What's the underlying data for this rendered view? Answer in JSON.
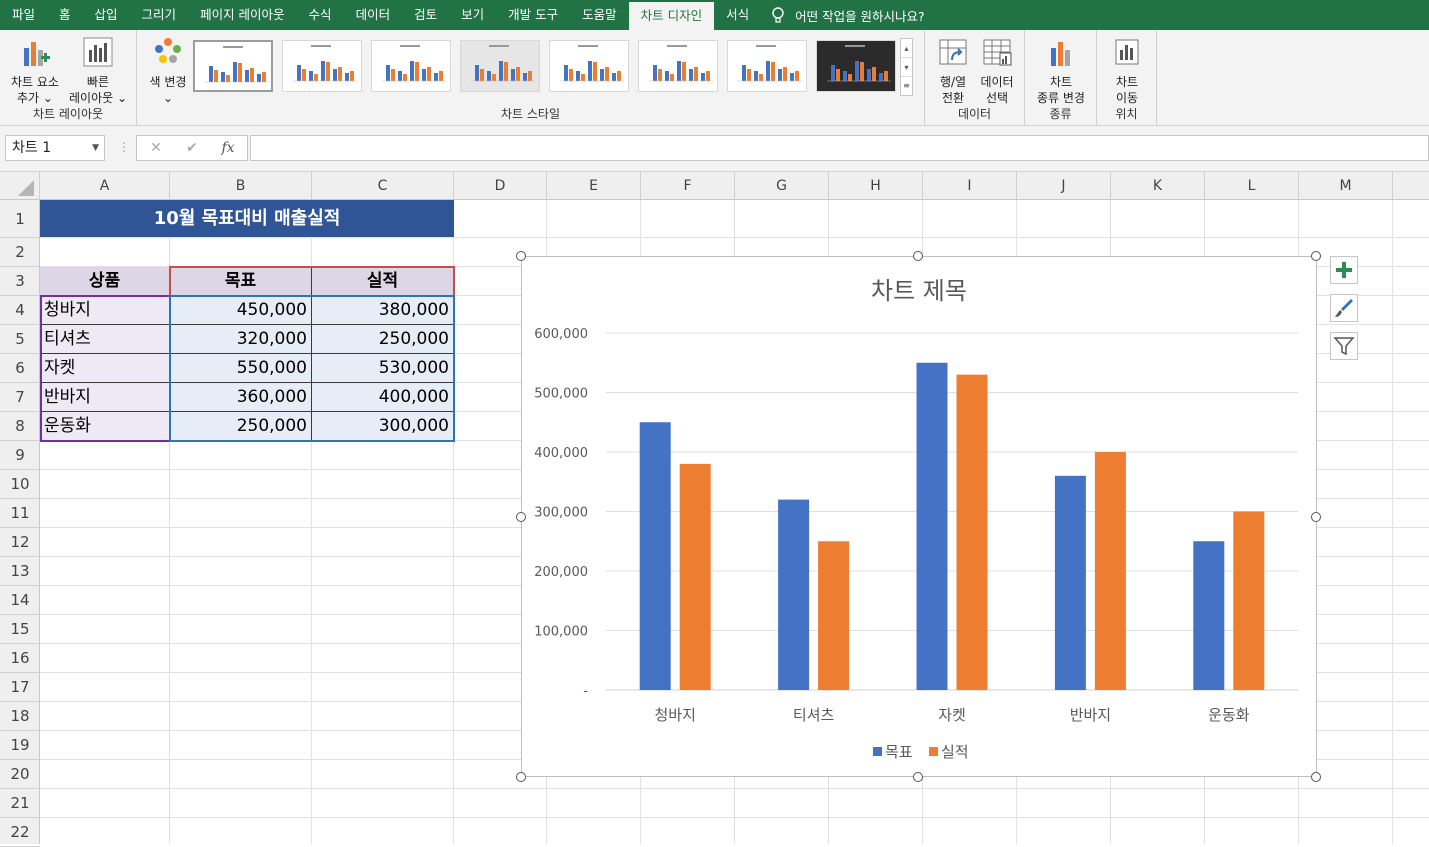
{
  "ribbon_tabs": [
    "파일",
    "홈",
    "삽입",
    "그리기",
    "페이지 레이아웃",
    "수식",
    "데이터",
    "검토",
    "보기",
    "개발 도구",
    "도움말",
    "차트 디자인",
    "서식"
  ],
  "active_tab": "차트 디자인",
  "tell_me": "어떤 작업을 원하시나요?",
  "ribbon": {
    "add_element": [
      "차트 요소",
      "추가 ⌄"
    ],
    "quick_layout": [
      "빠른",
      "레이아웃 ⌄"
    ],
    "layout_group": "차트 레이아웃",
    "change_colors": [
      "색 변경",
      "⌄"
    ],
    "styles_group": "차트 스타일",
    "switch_row_col": [
      "행/열",
      "전환"
    ],
    "select_data": [
      "데이터",
      "선택"
    ],
    "data_group": "데이터",
    "change_type": [
      "차트",
      "종류 변경"
    ],
    "type_group": "종류",
    "move_chart": [
      "차트",
      "이동"
    ],
    "location_group": "위치"
  },
  "formula_bar": {
    "name_box": "차트 1",
    "cancel": "✕",
    "enter": "✔",
    "fx": "fx",
    "formula": ""
  },
  "columns": [
    "A",
    "B",
    "C",
    "D",
    "E",
    "F",
    "G",
    "H",
    "I",
    "J",
    "K",
    "L",
    "M"
  ],
  "rows": [
    "1",
    "2",
    "3",
    "4",
    "5",
    "6",
    "7",
    "8",
    "9",
    "10",
    "11",
    "12",
    "13",
    "14",
    "15",
    "16",
    "17",
    "18",
    "19",
    "20",
    "21",
    "22"
  ],
  "sheet": {
    "title": "10월 목표대비 매출실적",
    "headers": [
      "상품",
      "목표",
      "실적"
    ],
    "data": [
      [
        "청바지",
        "450,000",
        "380,000"
      ],
      [
        "티셔츠",
        "320,000",
        "250,000"
      ],
      [
        "자켓",
        "550,000",
        "530,000"
      ],
      [
        "반바지",
        "360,000",
        "400,000"
      ],
      [
        "운동화",
        "250,000",
        "300,000"
      ]
    ],
    "title_bg": "#2f5597",
    "header_bg": "#dcd6e6",
    "name_bg": "#efe9f6",
    "num_bg": "#e6edf7"
  },
  "chart_data": {
    "type": "bar",
    "title": "차트 제목",
    "categories": [
      "청바지",
      "티셔츠",
      "자켓",
      "반바지",
      "운동화"
    ],
    "series": [
      {
        "name": "목표",
        "values": [
          450000,
          320000,
          550000,
          360000,
          250000
        ],
        "color": "#4472c4"
      },
      {
        "name": "실적",
        "values": [
          380000,
          250000,
          530000,
          400000,
          300000
        ],
        "color": "#ed7d31"
      }
    ],
    "ylim": [
      0,
      600000
    ],
    "yticks": [
      "-",
      "100,000",
      "200,000",
      "300,000",
      "400,000",
      "500,000",
      "600,000"
    ],
    "grid": true,
    "legend": "bottom"
  }
}
